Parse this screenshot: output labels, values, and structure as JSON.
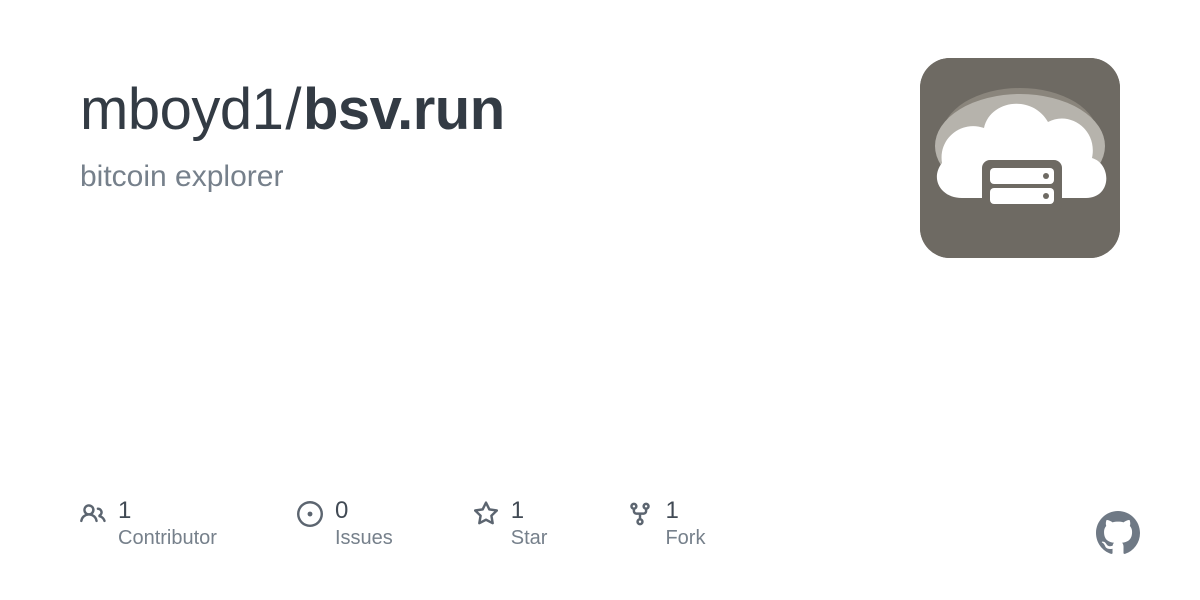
{
  "repo": {
    "owner": "mboyd1",
    "separator": "/",
    "name": "bsv.run",
    "description": "bitcoin explorer"
  },
  "stats": {
    "contributors": {
      "count": "1",
      "label": "Contributor"
    },
    "issues": {
      "count": "0",
      "label": "Issues"
    },
    "stars": {
      "count": "1",
      "label": "Star"
    },
    "forks": {
      "count": "1",
      "label": "Fork"
    }
  }
}
